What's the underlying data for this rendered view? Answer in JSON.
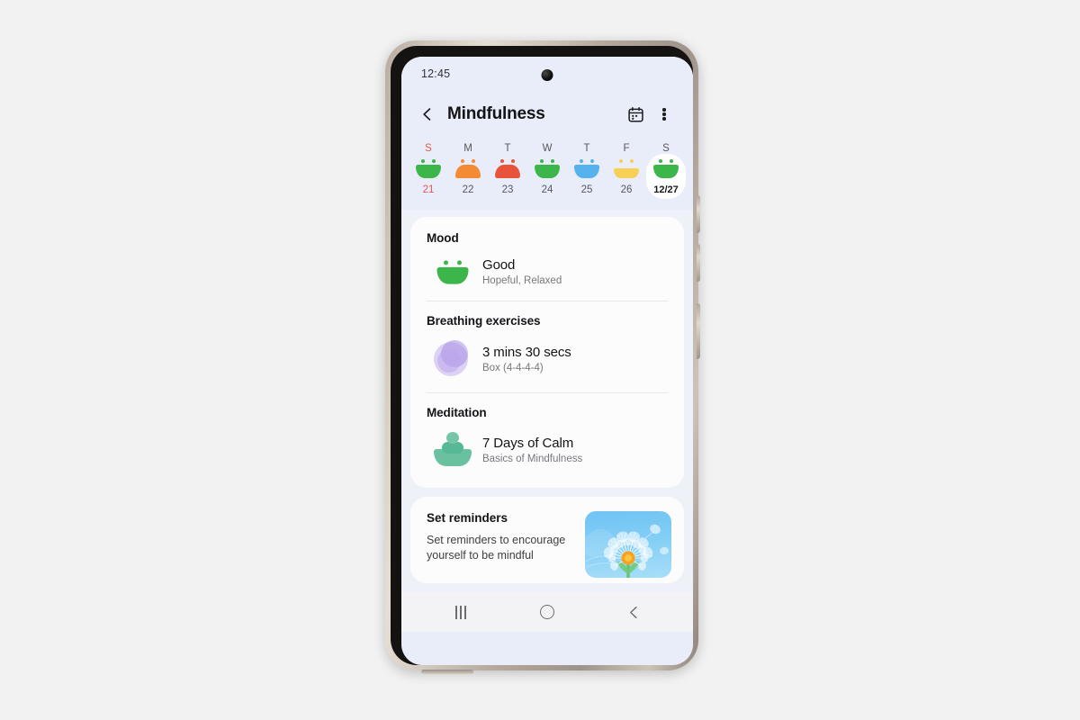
{
  "device": {
    "status_bar": {
      "time": "12:45"
    },
    "nav_bar": {
      "recents_label": "recents-button",
      "home_label": "home-button",
      "back_label": "back-button"
    }
  },
  "header": {
    "title": "Mindfulness",
    "back_icon": "chevron-left-icon",
    "calendar_icon": "calendar-icon",
    "menu_icon": "more-vertical-icon"
  },
  "week_strip": {
    "weekday_labels": [
      "S",
      "M",
      "T",
      "W",
      "T",
      "F",
      "S"
    ],
    "days": [
      {
        "label": "21",
        "mood": "happy",
        "color": "#3cb54a",
        "selected": false,
        "is_sunday": true
      },
      {
        "label": "22",
        "mood": "sad",
        "color": "#f58a35",
        "selected": false,
        "is_sunday": false
      },
      {
        "label": "23",
        "mood": "sad",
        "color": "#e8533c",
        "selected": false,
        "is_sunday": false
      },
      {
        "label": "24",
        "mood": "happy",
        "color": "#3cb54a",
        "selected": false,
        "is_sunday": false
      },
      {
        "label": "25",
        "mood": "happy",
        "color": "#56b2ec",
        "selected": false,
        "is_sunday": false
      },
      {
        "label": "26",
        "mood": "flat",
        "color": "#f7d055",
        "selected": false,
        "is_sunday": false
      },
      {
        "label": "12/27",
        "mood": "happy",
        "color": "#3cb54a",
        "selected": true,
        "is_sunday": false
      }
    ]
  },
  "summary_card": {
    "sections": [
      {
        "title": "Mood",
        "icon": "mood-happy-face-icon",
        "entry_title": "Good",
        "entry_sub": "Hopeful, Relaxed"
      },
      {
        "title": "Breathing exercises",
        "icon": "breathing-bubbles-icon",
        "entry_title": "3 mins 30 secs",
        "entry_sub": "Box (4-4-4-4)"
      },
      {
        "title": "Meditation",
        "icon": "meditation-figure-icon",
        "entry_title": "7 Days of Calm",
        "entry_sub": "Basics of Mindfulness"
      }
    ]
  },
  "reminder_card": {
    "title": "Set reminders",
    "description": "Set reminders to encourage yourself to be mindful",
    "artwork": "dandelion-illustration"
  },
  "colors": {
    "header_bg": "#e9edf9",
    "content_bg": "#eef1f7",
    "card_bg": "#fcfcfd",
    "mood_green": "#3cb54a",
    "mood_orange": "#f58a35",
    "mood_red": "#e8533c",
    "mood_blue": "#56b2ec",
    "mood_yellow": "#f7d055",
    "sunday_red": "#e2574c"
  }
}
